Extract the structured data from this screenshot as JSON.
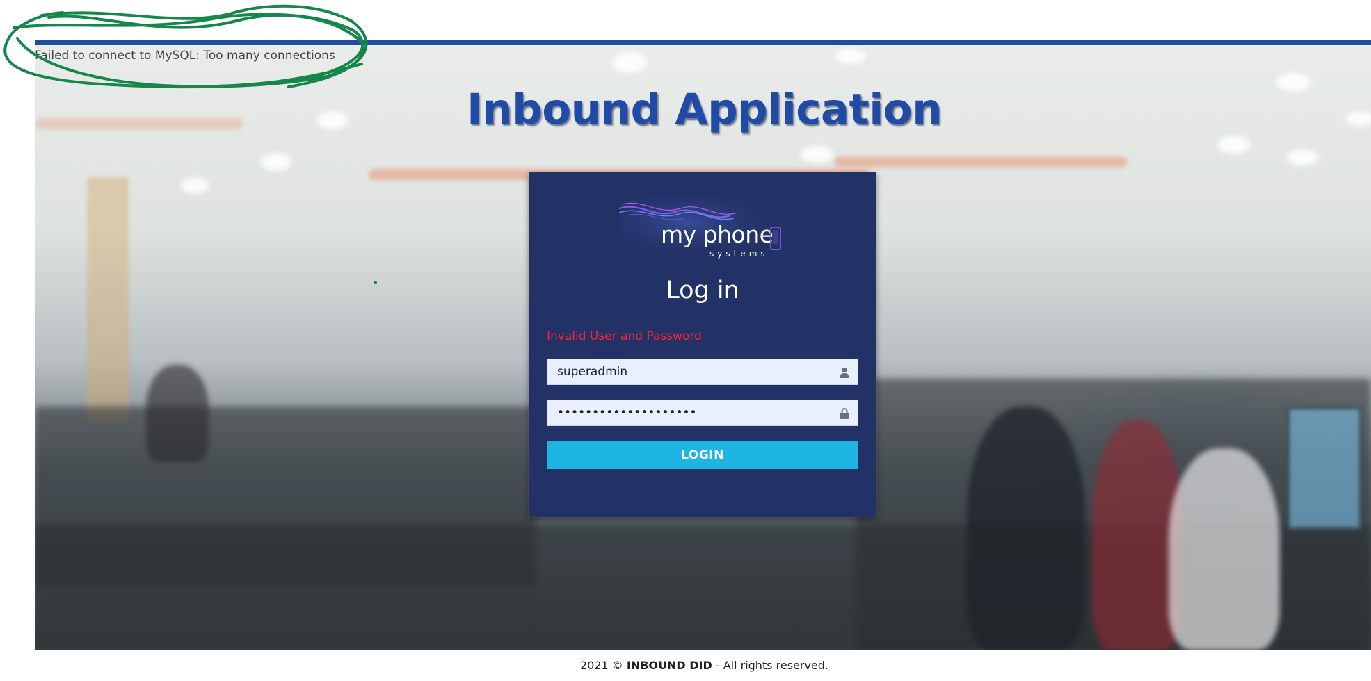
{
  "status": {
    "db_error": "Failed to connect to MySQL: Too many connections"
  },
  "app": {
    "title": "Inbound Application"
  },
  "login": {
    "logo_text": "my phone",
    "logo_subtext": "systems",
    "heading": "Log in",
    "error_message": "Invalid User and Password",
    "username_value": "superadmin",
    "username_icon": "user-icon",
    "password_value": "••••••••••••••••••••",
    "password_icon": "lock-icon",
    "submit_label": "LOGIN"
  },
  "footer": {
    "prefix": "2021 © ",
    "brand": "INBOUND DID",
    "suffix": " - All rights reserved."
  },
  "colors": {
    "accent_blue": "#1f4e9a",
    "card_bg": "#233266",
    "button": "#1fb5e3",
    "error_red": "#ff2233",
    "annotation_green": "#15874a"
  }
}
